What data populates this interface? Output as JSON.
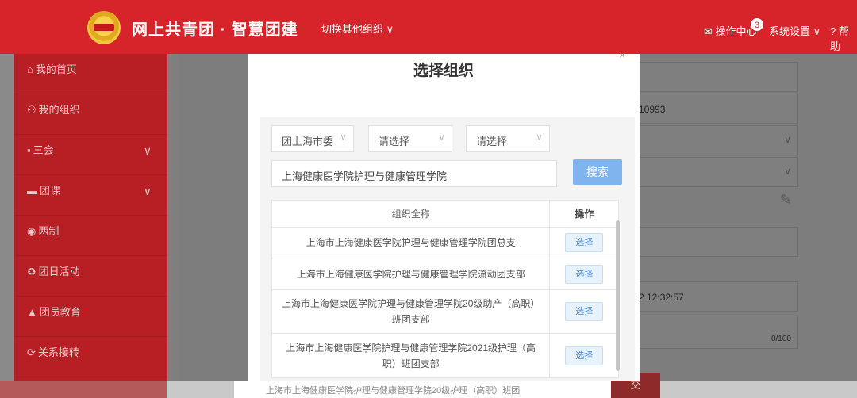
{
  "header": {
    "brand": "网上共青团 · 智慧团建",
    "switch_org": "切换其他组织 ∨",
    "ops_center": "✉ 操作中心",
    "badge_count": "3",
    "settings": "系统设置 ∨",
    "help": "? 帮助"
  },
  "sidebar": {
    "items": [
      {
        "icon": "home-icon",
        "glyph": "⌂",
        "label": "我的首页"
      },
      {
        "icon": "users-icon",
        "glyph": "⚇",
        "label": "我的组织"
      },
      {
        "icon": "edit-icon",
        "glyph": "▪",
        "label": "三会"
      },
      {
        "icon": "folder-icon",
        "glyph": "▬",
        "label": "团课"
      },
      {
        "icon": "circle-icon",
        "glyph": "◉",
        "label": "两制"
      },
      {
        "icon": "recycle-icon",
        "glyph": "♻",
        "label": "团日活动"
      },
      {
        "icon": "graduation-icon",
        "glyph": "▲",
        "label": "团员教育"
      },
      {
        "icon": "refresh-icon",
        "glyph": "⟳",
        "label": "关系接转"
      }
    ]
  },
  "background_form": {
    "id_value": "10993",
    "datetime_value": "2 12:32:57",
    "counter": "0/100",
    "submit_label": "交"
  },
  "modal": {
    "title": "选择组织",
    "close": "×",
    "filters": {
      "level1": "团上海市委",
      "level2": "请选择",
      "level3": "请选择"
    },
    "search_value": "上海健康医学院护理与健康管理学院",
    "search_button": "搜索",
    "table": {
      "col_name": "组织全称",
      "col_op": "操作",
      "rows": [
        {
          "name": "上海市上海健康医学院护理与健康管理学院团总支",
          "action": "选择"
        },
        {
          "name": "上海市上海健康医学院护理与健康管理学院流动团支部",
          "action": "选择"
        },
        {
          "name": "上海市上海健康医学院护理与健康管理学院20级助产（高职）班团支部",
          "action": "选择"
        },
        {
          "name": "上海市上海健康医学院护理与健康管理学院2021级护理（高职）班团支部",
          "action": "选择"
        }
      ]
    }
  },
  "overflow_row": "上海市上海健康医学院护理与健康管理学院20级护理（高职）班团"
}
